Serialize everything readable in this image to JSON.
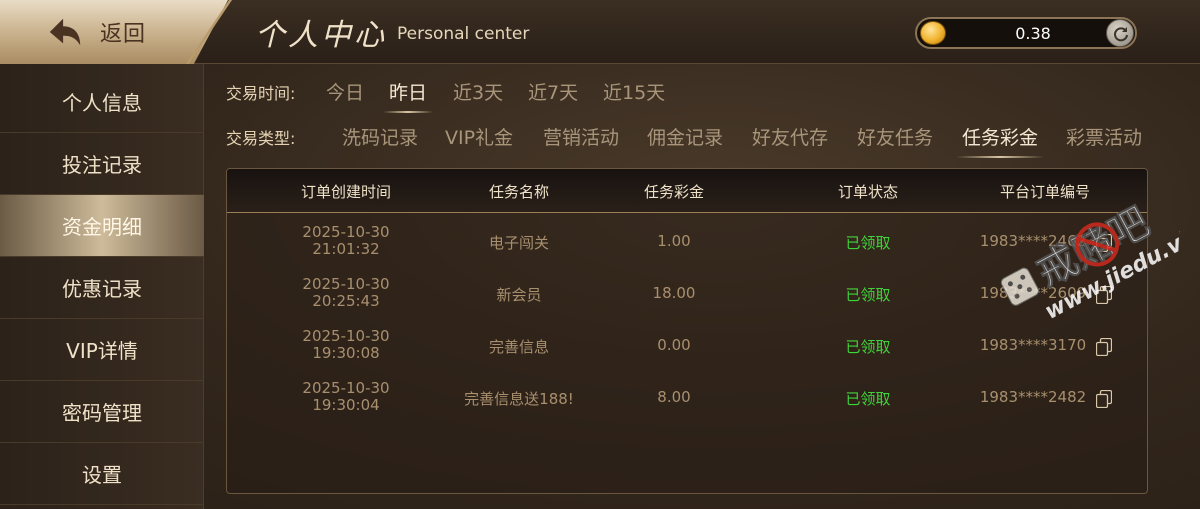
{
  "header": {
    "back_label": "返回",
    "title_cn": "个人中心",
    "title_en": "Personal center",
    "balance": "0.38",
    "coin_icon": "coin-icon",
    "refresh_icon": "refresh-icon"
  },
  "sidebar": {
    "items": [
      {
        "label": "个人信息"
      },
      {
        "label": "投注记录"
      },
      {
        "label": "资金明细"
      },
      {
        "label": "优惠记录"
      },
      {
        "label": "VIP详情"
      },
      {
        "label": "密码管理"
      },
      {
        "label": "设置"
      }
    ],
    "active_index": 2
  },
  "filters": {
    "time_label": "交易时间:",
    "time_tabs": [
      "今日",
      "昨日",
      "近3天",
      "近7天",
      "近15天"
    ],
    "time_active": "昨日",
    "type_label": "交易类型:",
    "type_tabs": [
      "洗码记录",
      "VIP礼金",
      "营销活动",
      "佣金记录",
      "好友代存",
      "好友任务",
      "任务彩金",
      "彩票活动"
    ],
    "type_active": "任务彩金"
  },
  "table": {
    "headers": [
      "订单创建时间",
      "任务名称",
      "任务彩金",
      "订单状态",
      "平台订单编号"
    ],
    "rows": [
      {
        "date": "2025-10-30",
        "time": "21:01:32",
        "name": "电子闯关",
        "amount": "1.00",
        "status": "已领取",
        "order_no": "1983****2462"
      },
      {
        "date": "2025-10-30",
        "time": "20:25:43",
        "name": "新会员",
        "amount": "18.00",
        "status": "已领取",
        "order_no": "1983****2609"
      },
      {
        "date": "2025-10-30",
        "time": "19:30:08",
        "name": "完善信息",
        "amount": "0.00",
        "status": "已领取",
        "order_no": "1983****3170"
      },
      {
        "date": "2025-10-30",
        "time": "19:30:04",
        "name": "完善信息送188!",
        "amount": "8.00",
        "status": "已领取",
        "order_no": "1983****2482"
      }
    ]
  },
  "watermark": {
    "text_cn": "戒赌吧",
    "text_url": "www.jiedu.vip"
  },
  "colors": {
    "status_green": "#3fd43a",
    "gold": "#b89a6c",
    "panel_border": "#6b5640"
  }
}
